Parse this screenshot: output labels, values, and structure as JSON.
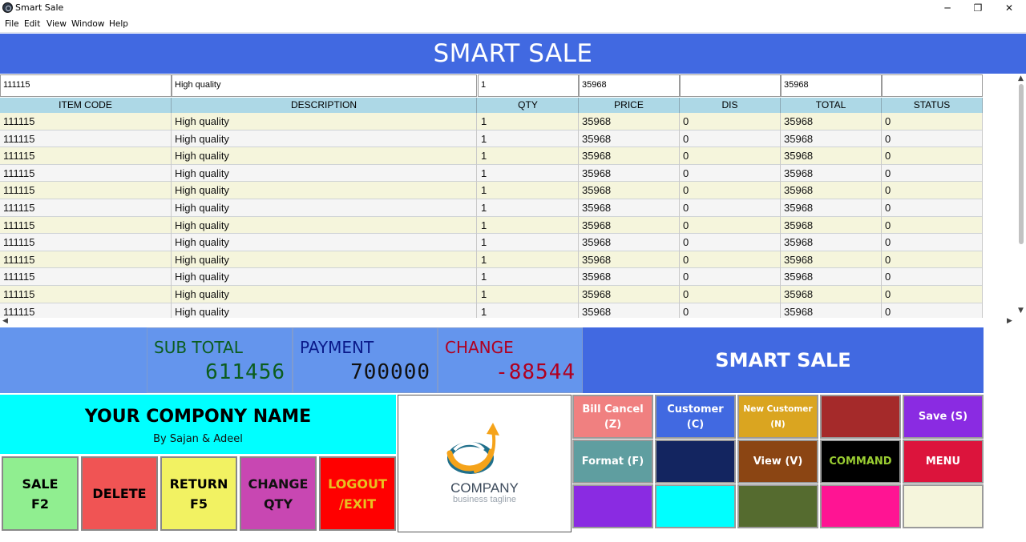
{
  "window": {
    "title": "Smart Sale",
    "controls": {
      "minimize": "─",
      "maximize": "❐",
      "close": "✕"
    }
  },
  "menu": [
    "File",
    "Edit",
    "View",
    "Window",
    "Help"
  ],
  "header_title": "SMART SALE",
  "entry": {
    "item_code": "111115",
    "description": "High quality",
    "qty": "1",
    "price": "35968",
    "dis": "",
    "total": "35968",
    "status": ""
  },
  "table": {
    "columns": [
      "ITEM CODE",
      "DESCRIPTION",
      "QTY",
      "PRICE",
      "DIS",
      "TOTAL",
      "STATUS"
    ],
    "rows": [
      [
        "111115",
        "High quality",
        "1",
        "35968",
        "0",
        "35968",
        "0"
      ],
      [
        "111115",
        "High quality",
        "1",
        "35968",
        "0",
        "35968",
        "0"
      ],
      [
        "111115",
        "High quality",
        "1",
        "35968",
        "0",
        "35968",
        "0"
      ],
      [
        "111115",
        "High quality",
        "1",
        "35968",
        "0",
        "35968",
        "0"
      ],
      [
        "111115",
        "High quality",
        "1",
        "35968",
        "0",
        "35968",
        "0"
      ],
      [
        "111115",
        "High quality",
        "1",
        "35968",
        "0",
        "35968",
        "0"
      ],
      [
        "111115",
        "High quality",
        "1",
        "35968",
        "0",
        "35968",
        "0"
      ],
      [
        "111115",
        "High quality",
        "1",
        "35968",
        "0",
        "35968",
        "0"
      ],
      [
        "111115",
        "High quality",
        "1",
        "35968",
        "0",
        "35968",
        "0"
      ],
      [
        "111115",
        "High quality",
        "1",
        "35968",
        "0",
        "35968",
        "0"
      ],
      [
        "111115",
        "High quality",
        "1",
        "35968",
        "0",
        "35968",
        "0"
      ],
      [
        "111115",
        "High quality",
        "1",
        "35968",
        "0",
        "35968",
        "0"
      ]
    ]
  },
  "totals": {
    "sub_total_label": "SUB TOTAL",
    "sub_total_value": "611456",
    "payment_label": "PAYMENT",
    "payment_value": "700000",
    "change_label": "CHANGE",
    "change_value": "-88544"
  },
  "brand_panel": "SMART SALE",
  "company": {
    "name": "YOUR COMPONY NAME",
    "byline": "By Sajan & Adeel",
    "logo_name": "COMPANY",
    "logo_tagline": "business tagline"
  },
  "actions": [
    {
      "label": "SALE\nF2",
      "bg": "#90ee90",
      "color": "#000000"
    },
    {
      "label": "DELETE",
      "bg": "#f05454",
      "color": "#000000"
    },
    {
      "label": "RETURN\nF5",
      "bg": "#f2f262",
      "color": "#000000"
    },
    {
      "label": "CHANGE\nQTY",
      "bg": "#c847b2",
      "color": "#111111"
    },
    {
      "label": "LOGOUT\n/EXIT",
      "bg": "#ff0000",
      "color": "#e8c020"
    }
  ],
  "grid": [
    [
      {
        "label": "Bill Cancel\n(Z)",
        "bg": "#f08080",
        "color": "#ffffff"
      },
      {
        "label": "Customer\n(C)",
        "bg": "#4169e1",
        "color": "#ffffff"
      },
      {
        "label": "New Customer\n(N)",
        "bg": "#daa520",
        "color": "#ffffff"
      },
      {
        "label": "",
        "bg": "#a52a2a",
        "color": "#ffffff"
      },
      {
        "label": "Save (S)",
        "bg": "#8a2be2",
        "color": "#ffffff"
      }
    ],
    [
      {
        "label": "Format (F)",
        "bg": "#5f9ea0",
        "color": "#ffffff"
      },
      {
        "label": "",
        "bg": "#132560",
        "color": "#ffffff"
      },
      {
        "label": "View (V)",
        "bg": "#8b4513",
        "color": "#ffffff"
      },
      {
        "label": "COMMAND",
        "bg": "#000000",
        "color": "#9acd32"
      },
      {
        "label": "MENU",
        "bg": "#dc143c",
        "color": "#ffffff"
      }
    ],
    [
      {
        "label": "",
        "bg": "#8a2be2",
        "color": "#ffffff"
      },
      {
        "label": "",
        "bg": "#00ffff",
        "color": "#ffffff"
      },
      {
        "label": "",
        "bg": "#556b2f",
        "color": "#ffffff"
      },
      {
        "label": "",
        "bg": "#ff1493",
        "color": "#ffffff"
      },
      {
        "label": "",
        "bg": "#f5f5dc",
        "color": "#ffffff"
      }
    ]
  ],
  "colors": {
    "header_bg": "#4169e1",
    "totals_bg": "#6495ed",
    "sub_total_color": "#0b5d1e",
    "payment_color": "#0a1a8a",
    "change_color": "#b00020",
    "table_header_bg": "#add8e6"
  }
}
